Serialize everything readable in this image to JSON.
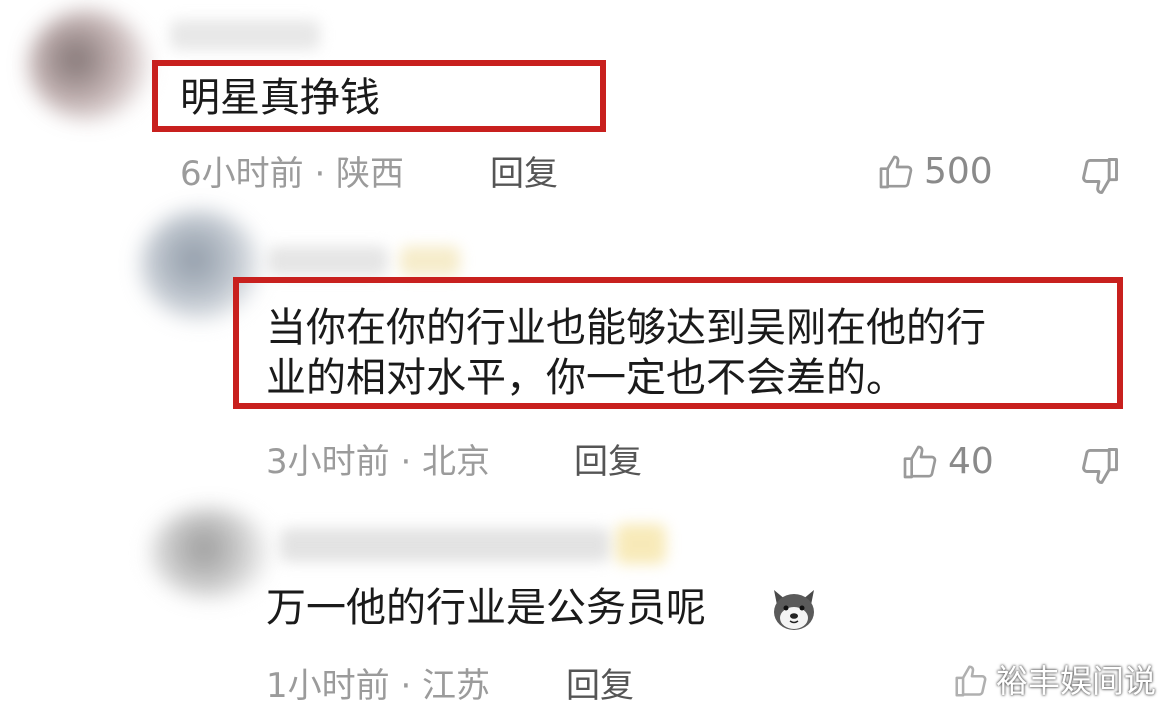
{
  "comments": [
    {
      "text": "明星真挣钱",
      "time_location": "6小时前 · 陕西",
      "reply_label": "回复",
      "likes": "500"
    },
    {
      "text_line1": "当你在你的行业也能够达到吴刚在他的行",
      "text_line2": "业的相对水平，你一定也不会差的。",
      "time_location": "3小时前 · 北京",
      "reply_label": "回复",
      "likes": "40"
    },
    {
      "text": "万一他的行业是公务员呢",
      "emoji": "dog-face-emoji",
      "time_location": "1小时前 · 江苏",
      "reply_label": "回复"
    }
  ],
  "watermark": {
    "text": "裕丰娱间说"
  },
  "colors": {
    "highlight": "#c8201e",
    "meta_gray": "#9b9b9b",
    "text": "#1a1a1a"
  }
}
